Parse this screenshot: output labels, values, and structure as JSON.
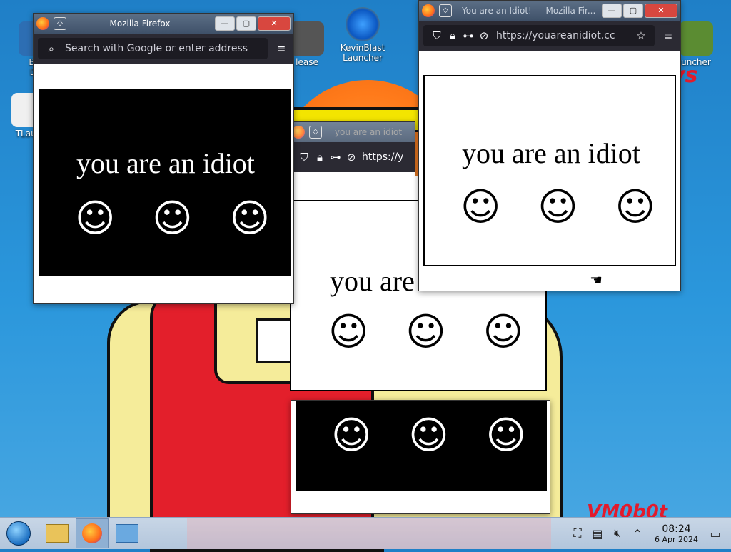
{
  "desktop": {
    "icons": [
      {
        "label": "Big\nDe",
        "name": "desktop-icon-big"
      },
      {
        "label": "TLaun",
        "name": "desktop-icon-tlauncher"
      },
      {
        "label": "lease",
        "name": "desktop-icon-release"
      },
      {
        "label": "KevinBlast\nLauncher",
        "name": "desktop-icon-kevinblast"
      },
      {
        "label": "uncher",
        "name": "desktop-icon-launcher"
      }
    ],
    "watermark": "VM0b0t",
    "red_logo": "ys"
  },
  "windows": {
    "win1": {
      "title": "Mozilla Firefox",
      "search_placeholder": "Search with Google or enter address",
      "page_text": "you are an idiot",
      "bg": "#000000",
      "fg": "#ffffff"
    },
    "win_back": {
      "title": "you are an idiot",
      "url": "https://y"
    },
    "win2": {
      "title": "You are an Idiot! — Mozilla Fir...",
      "url": "https://youareanidiot.cc",
      "page_text": "you are an idiot",
      "bg": "#ffffff",
      "fg": "#000000"
    },
    "win3": {
      "page_text": "you are"
    }
  },
  "smiley_glyph": "☺",
  "taskbar": {
    "clock_time": "08:24",
    "clock_date": "6 Apr 2024"
  },
  "colors": {
    "accent": "#2b2a33",
    "desktop_bg": "#2b97dc"
  }
}
